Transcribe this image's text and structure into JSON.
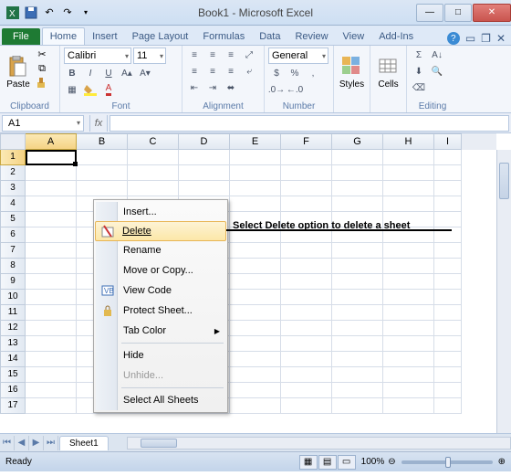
{
  "title": "Book1 - Microsoft Excel",
  "tabs": {
    "file": "File",
    "home": "Home",
    "insert": "Insert",
    "pagelayout": "Page Layout",
    "formulas": "Formulas",
    "data": "Data",
    "review": "Review",
    "view": "View",
    "addins": "Add-Ins"
  },
  "ribbon": {
    "clipboard": {
      "label": "Clipboard",
      "paste": "Paste"
    },
    "font": {
      "label": "Font",
      "name": "Calibri",
      "size": "11"
    },
    "alignment": {
      "label": "Alignment"
    },
    "number": {
      "label": "Number",
      "format": "General"
    },
    "styles": {
      "label": "Styles"
    },
    "cells": {
      "label": "Cells"
    },
    "editing": {
      "label": "Editing"
    }
  },
  "namebox": "A1",
  "columns": [
    "A",
    "B",
    "C",
    "D",
    "E",
    "F",
    "G",
    "H",
    "I"
  ],
  "rows": [
    "1",
    "2",
    "3",
    "4",
    "5",
    "6",
    "7",
    "8",
    "9",
    "10",
    "11",
    "12",
    "13",
    "14",
    "15",
    "16",
    "17"
  ],
  "sheet_tab": "Sheet1",
  "status": "Ready",
  "zoom": "100%",
  "context_menu": {
    "insert": "Insert...",
    "delete": "Delete",
    "rename": "Rename",
    "move": "Move or Copy...",
    "viewcode": "View Code",
    "protect": "Protect Sheet...",
    "tabcolor": "Tab Color",
    "hide": "Hide",
    "unhide": "Unhide...",
    "selectall": "Select All Sheets"
  },
  "annotation": "Select Delete option to delete a sheet"
}
